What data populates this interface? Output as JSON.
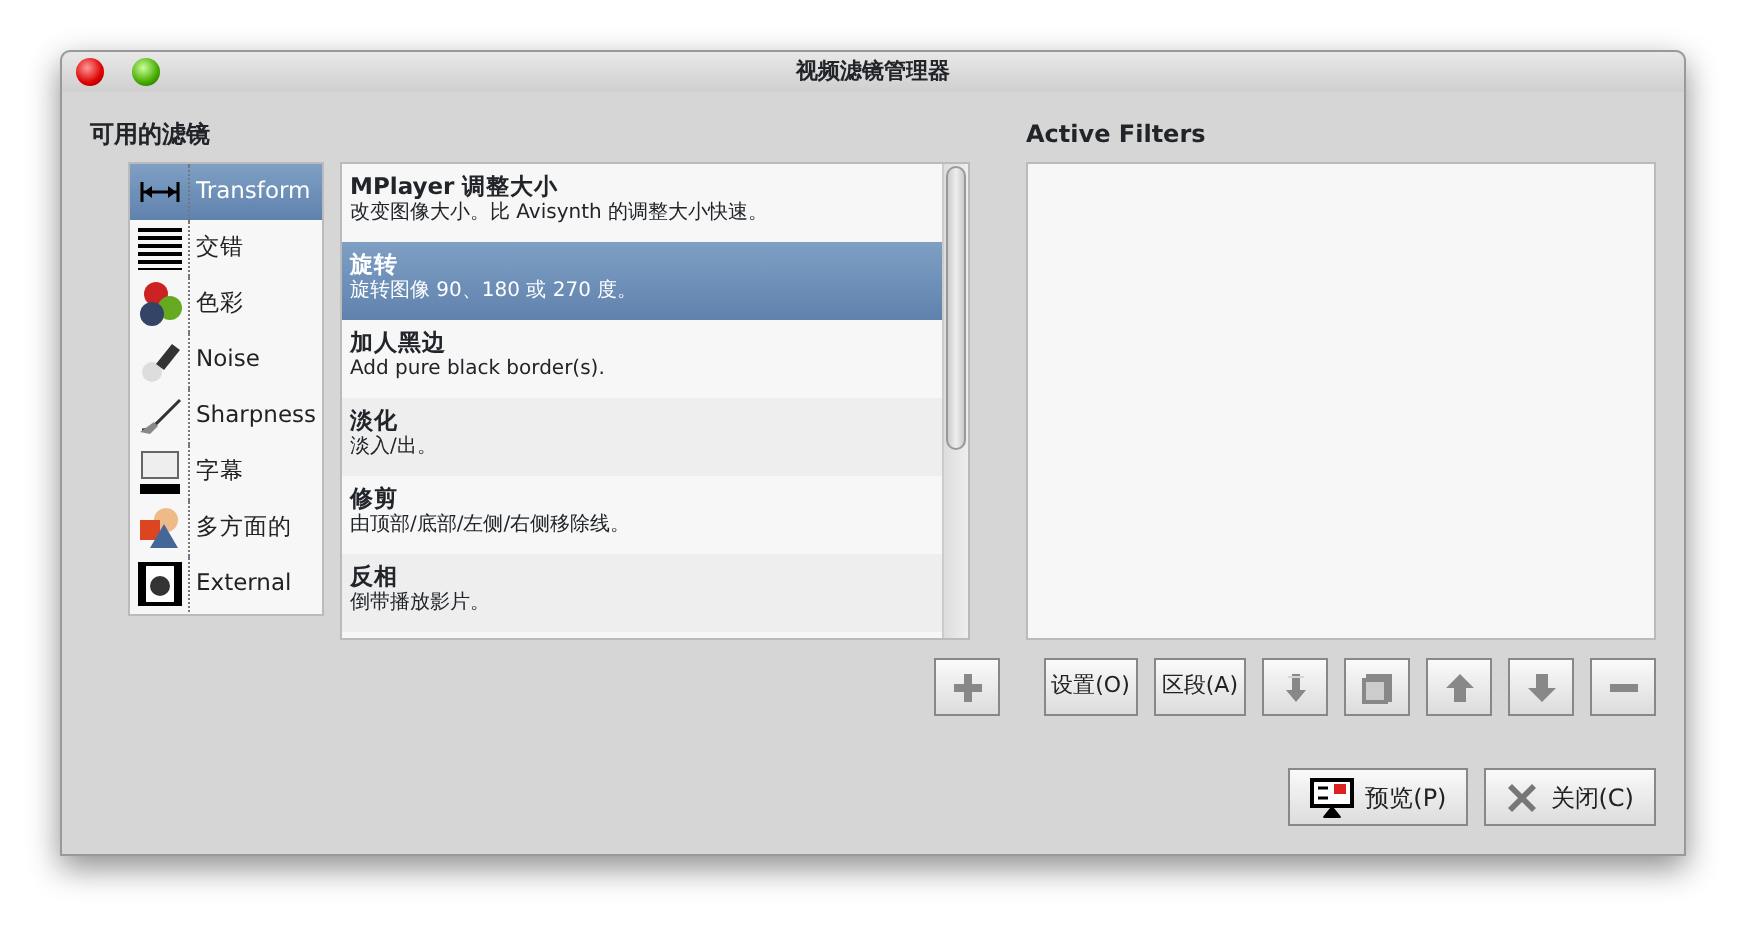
{
  "window": {
    "title": "视频滤镜管理器"
  },
  "available": {
    "label": "可用的滤镜",
    "categories": [
      {
        "label": "Transform",
        "selected": true
      },
      {
        "label": "交错",
        "selected": false
      },
      {
        "label": "色彩",
        "selected": false
      },
      {
        "label": "Noise",
        "selected": false
      },
      {
        "label": "Sharpness",
        "selected": false
      },
      {
        "label": "字幕",
        "selected": false
      },
      {
        "label": "多方面的",
        "selected": false
      },
      {
        "label": "External",
        "selected": false
      }
    ],
    "filters": [
      {
        "name": "MPlayer 调整大小",
        "description": "改变图像大小。比 Avisynth 的调整大小快速。",
        "selected": false
      },
      {
        "name": "旋转",
        "description": "旋转图像 90、180 或 270 度。",
        "selected": true
      },
      {
        "name": "加人黑边",
        "description": "Add pure black border(s).",
        "selected": false
      },
      {
        "name": "淡化",
        "description": "淡入/出。",
        "selected": false
      },
      {
        "name": "修剪",
        "description": "由顶部/底部/左侧/右侧移除线。",
        "selected": false
      },
      {
        "name": "反相",
        "description": "倒带播放影片。",
        "selected": false
      }
    ]
  },
  "active": {
    "label": "Active Filters"
  },
  "toolbar": [
    {
      "kind": "text",
      "label": "设置(O)"
    },
    {
      "kind": "text",
      "label": "区段(A)"
    },
    {
      "kind": "bottom"
    },
    {
      "kind": "copy"
    },
    {
      "kind": "up"
    },
    {
      "kind": "down"
    },
    {
      "kind": "remove"
    }
  ],
  "dialog_buttons": [
    {
      "kind": "preview",
      "label": "预览(P)"
    },
    {
      "kind": "close",
      "label": "关闭(C)"
    }
  ]
}
